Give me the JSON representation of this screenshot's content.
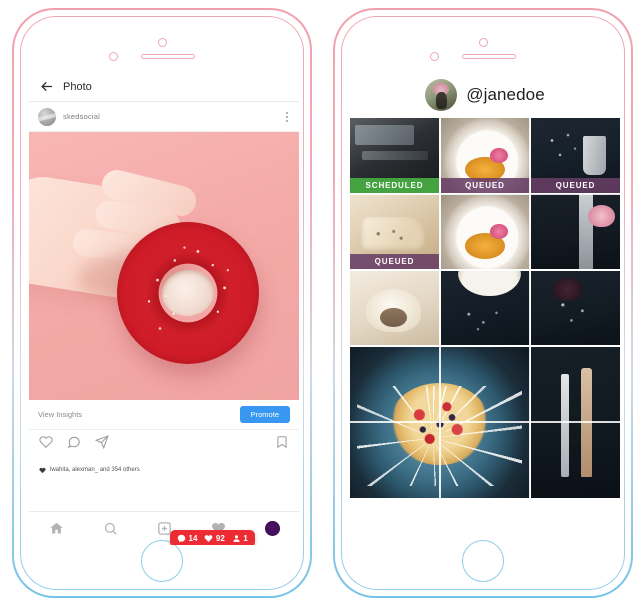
{
  "left_phone": {
    "nav": {
      "back_icon": "back-arrow-icon",
      "title": "Photo"
    },
    "post_header": {
      "username": "skedsocial",
      "avatar": "user-avatar",
      "more_icon": "more-options-icon"
    },
    "post_image_alt": "hand holding red glazed donut with sprinkles on pink background",
    "insights": {
      "link_label": "View Insights",
      "promote_label": "Promote",
      "promote_color": "#3897f0"
    },
    "actions": {
      "like_icon": "heart-icon",
      "comment_icon": "comment-icon",
      "share_icon": "share-icon",
      "save_icon": "bookmark-icon"
    },
    "engagement_tooltip": {
      "background_color": "#ed2b33",
      "metrics": [
        {
          "icon": "comment-icon",
          "value": "14"
        },
        {
          "icon": "heart-icon",
          "value": "92"
        },
        {
          "icon": "profile-icon",
          "value": "1"
        }
      ]
    },
    "likes": {
      "heart_icon": "heart-filled-icon",
      "text": "lwahita, alexman_ and 354 others"
    },
    "tabbar": {
      "items": [
        {
          "icon": "home-icon",
          "name": "home",
          "active": false
        },
        {
          "icon": "search-icon",
          "name": "search",
          "active": false
        },
        {
          "icon": "add-post-icon",
          "name": "add",
          "active": false
        },
        {
          "icon": "heart-icon",
          "name": "activity",
          "active": true
        },
        {
          "icon": "profile-avatar-icon",
          "name": "profile",
          "active": false
        }
      ],
      "avatar_color": "#4a1060",
      "notification_dot_color": "#ed2b33"
    }
  },
  "right_phone": {
    "profile": {
      "handle": "@janedoe",
      "avatar": "profile-avatar"
    },
    "badges": {
      "scheduled_label": "SCHEDULED",
      "scheduled_color": "#44a340",
      "queued_label": "QUEUED",
      "queued_color": "#683e65"
    },
    "grid": [
      {
        "name": "dark-tools",
        "art": "img-dark-tools",
        "badge": "SCHEDULED",
        "badge_type": "scheduled",
        "col": 1,
        "row": 1,
        "col_span": 1,
        "row_span": 1
      },
      {
        "name": "plate-flower",
        "art": "img-plate-flower",
        "badge": "QUEUED",
        "badge_type": "queued",
        "col": 2,
        "row": 1,
        "col_span": 1,
        "row_span": 1
      },
      {
        "name": "dark-fork",
        "art": "img-dark-fork",
        "badge": "QUEUED",
        "badge_type": "queued",
        "col": 3,
        "row": 1,
        "col_span": 1,
        "row_span": 1
      },
      {
        "name": "bread-slices",
        "art": "img-bread",
        "badge": "QUEUED",
        "badge_type": "queued",
        "col": 1,
        "row": 2,
        "col_span": 1,
        "row_span": 1
      },
      {
        "name": "orange-tart-plate",
        "art": "img-plate-flower",
        "badge": "",
        "badge_type": "",
        "col": 2,
        "row": 2,
        "col_span": 1,
        "row_span": 1
      },
      {
        "name": "rose-fork",
        "art": "img-rose-fork",
        "badge": "",
        "badge_type": "",
        "col": 3,
        "row": 2,
        "col_span": 1,
        "row_span": 1
      },
      {
        "name": "cream-dessert",
        "art": "img-cream",
        "badge": "",
        "badge_type": "",
        "col": 1,
        "row": 3,
        "col_span": 1,
        "row_span": 1
      },
      {
        "name": "dark-crumbs",
        "art": "img-dark-crumb",
        "badge": "",
        "badge_type": "",
        "col": 2,
        "row": 3,
        "col_span": 1,
        "row_span": 1
      },
      {
        "name": "dark-berry",
        "art": "img-dark-berry",
        "badge": "",
        "badge_type": "",
        "col": 3,
        "row": 3,
        "col_span": 1,
        "row_span": 1
      },
      {
        "name": "berry-tart-blue-plate",
        "art": "img-big-tart",
        "badge": "",
        "badge_type": "",
        "col": 1,
        "row": 4,
        "col_span": 2,
        "row_span": 2,
        "splash": true
      },
      {
        "name": "cutlery-dark",
        "art": "img-cutlery",
        "badge": "",
        "badge_type": "",
        "col": 3,
        "row": 4,
        "col_span": 1,
        "row_span": 2
      }
    ]
  }
}
